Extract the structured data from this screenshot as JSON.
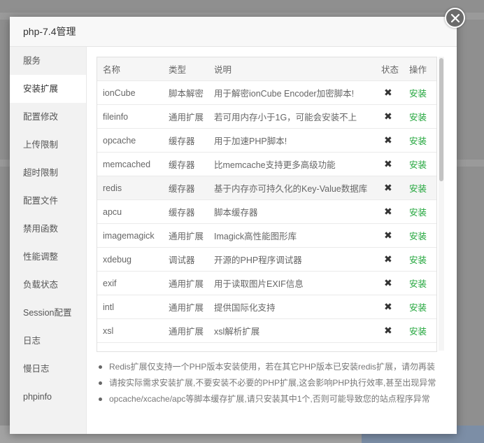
{
  "dialog": {
    "title": "php-7.4管理"
  },
  "sidebar": {
    "items": [
      {
        "label": "服务"
      },
      {
        "label": "安装扩展"
      },
      {
        "label": "配置修改"
      },
      {
        "label": "上传限制"
      },
      {
        "label": "超时限制"
      },
      {
        "label": "配置文件"
      },
      {
        "label": "禁用函数"
      },
      {
        "label": "性能调整"
      },
      {
        "label": "负载状态"
      },
      {
        "label": "Session配置"
      },
      {
        "label": "日志"
      },
      {
        "label": "慢日志"
      },
      {
        "label": "phpinfo"
      }
    ],
    "active_index": 1
  },
  "table": {
    "headers": {
      "name": "名称",
      "type": "类型",
      "desc": "说明",
      "status": "状态",
      "op": "操作"
    },
    "rows": [
      {
        "name": "ionCube",
        "type": "脚本解密",
        "desc": "用于解密ionCube Encoder加密脚本!",
        "status": "✖",
        "op": "安装"
      },
      {
        "name": "fileinfo",
        "type": "通用扩展",
        "desc": "若可用内存小于1G，可能会安装不上",
        "status": "✖",
        "op": "安装"
      },
      {
        "name": "opcache",
        "type": "缓存器",
        "desc": "用于加速PHP脚本!",
        "status": "✖",
        "op": "安装"
      },
      {
        "name": "memcached",
        "type": "缓存器",
        "desc": "比memcache支持更多高级功能",
        "status": "✖",
        "op": "安装"
      },
      {
        "name": "redis",
        "type": "缓存器",
        "desc": "基于内存亦可持久化的Key-Value数据库",
        "status": "✖",
        "op": "安装"
      },
      {
        "name": "apcu",
        "type": "缓存器",
        "desc": "脚本缓存器",
        "status": "✖",
        "op": "安装"
      },
      {
        "name": "imagemagick",
        "type": "通用扩展",
        "desc": "Imagick高性能图形库",
        "status": "✖",
        "op": "安装"
      },
      {
        "name": "xdebug",
        "type": "调试器",
        "desc": "开源的PHP程序调试器",
        "status": "✖",
        "op": "安装"
      },
      {
        "name": "exif",
        "type": "通用扩展",
        "desc": "用于读取图片EXIF信息",
        "status": "✖",
        "op": "安装"
      },
      {
        "name": "intl",
        "type": "通用扩展",
        "desc": "提供国际化支持",
        "status": "✖",
        "op": "安装"
      },
      {
        "name": "xsl",
        "type": "通用扩展",
        "desc": "xsl解析扩展",
        "status": "✖",
        "op": "安装"
      }
    ]
  },
  "notes": [
    "Redis扩展仅支持一个PHP版本安装使用，若在其它PHP版本已安装redis扩展，请勿再装",
    "请按实际需求安装扩展,不要安装不必要的PHP扩展,这会影响PHP执行效率,甚至出现异常",
    "opcache/xcache/apc等脚本缓存扩展,请只安装其中1个,否则可能导致您的站点程序异常"
  ],
  "colors": {
    "install_link": "#20a53a",
    "close_button": "#6b6b6b"
  },
  "icons": {
    "close": "close-icon",
    "status_not_installed": "cross-icon"
  }
}
